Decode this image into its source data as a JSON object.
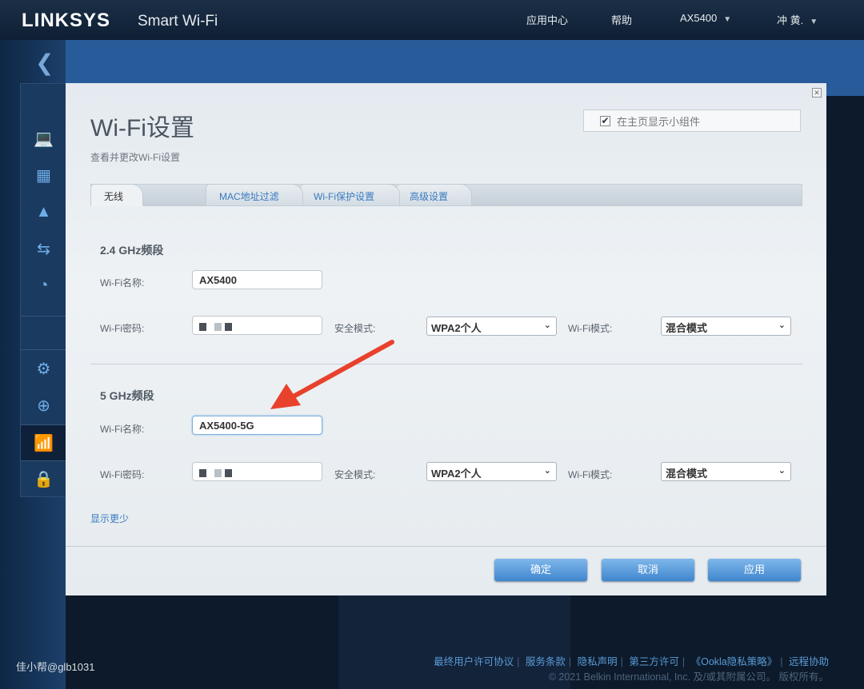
{
  "header": {
    "logo": "LINKSYS",
    "logo_suffix": "Smart Wi-Fi",
    "nav": [
      "应用中心",
      "帮助"
    ],
    "router": "AX5400",
    "user": "冲 黄."
  },
  "modal": {
    "title": "Wi-Fi设置",
    "subtitle": "查看并更改Wi-Fi设置",
    "widget_label": "在主页显示小组件",
    "widget_checked": true,
    "tabs": [
      "无线",
      "MAC地址过滤",
      "Wi-Fi保护设置",
      "高级设置"
    ],
    "band24": {
      "heading": "2.4 GHz频段",
      "name_label": "Wi-Fi名称:",
      "name": "AX5400",
      "pwd_label": "Wi-Fi密码:",
      "sec_label": "安全模式:",
      "security": "WPA2个人",
      "mode_label": "Wi-Fi模式:",
      "mode": "混合模式"
    },
    "band5": {
      "heading": "5 GHz频段",
      "name_label": "Wi-Fi名称:",
      "name": "AX5400-5G",
      "pwd_label": "Wi-Fi密码:",
      "sec_label": "安全模式:",
      "security": "WPA2个人",
      "mode_label": "Wi-Fi模式:",
      "mode": "混合模式"
    },
    "show_less": "显示更少",
    "buttons": {
      "ok": "确定",
      "cancel": "取消",
      "apply": "应用"
    }
  },
  "footer": {
    "links": [
      "最终用户许可协议",
      "服务条款",
      "隐私声明",
      "第三方许可",
      "《Ookla隐私策略》",
      "远程协助"
    ],
    "copyright": "© 2021 Belkin International, Inc. 及/或其附属公司。 版权所有。"
  },
  "watermark": "佳小帮@glb1031",
  "colors": {
    "accent": "#3f86cf",
    "arrow": "#e8412c"
  }
}
